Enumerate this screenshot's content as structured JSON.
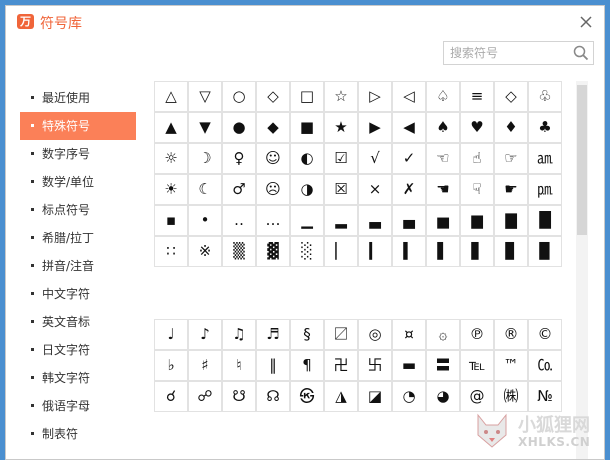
{
  "app": {
    "title": "符号库",
    "logo_glyph": "万"
  },
  "search": {
    "placeholder": "搜索符号",
    "value": ""
  },
  "sidebar": {
    "active_index": 1,
    "items": [
      {
        "label": "最近使用"
      },
      {
        "label": "特殊符号"
      },
      {
        "label": "数字序号"
      },
      {
        "label": "数学/单位"
      },
      {
        "label": "标点符号"
      },
      {
        "label": "希腊/拉丁"
      },
      {
        "label": "拼音/注音"
      },
      {
        "label": "中文字符"
      },
      {
        "label": "英文音标"
      },
      {
        "label": "日文字符"
      },
      {
        "label": "韩文字符"
      },
      {
        "label": "俄语字母"
      },
      {
        "label": "制表符"
      }
    ]
  },
  "grid1": {
    "rows": [
      [
        "△",
        "▽",
        "○",
        "◇",
        "□",
        "☆",
        "▷",
        "◁",
        "♤",
        "≡",
        "◇",
        "♧"
      ],
      [
        "▲",
        "▼",
        "●",
        "◆",
        "■",
        "★",
        "▶",
        "◀",
        "♠",
        "♥",
        "♦",
        "♣"
      ],
      [
        "☼",
        "☽",
        "♀",
        "☺",
        "◐",
        "☑",
        "√",
        "✓",
        "☜",
        "☝",
        "☞",
        "㏂"
      ],
      [
        "☀",
        "☾",
        "♂",
        "☹",
        "◑",
        "☒",
        "×",
        "✗",
        "☚",
        "☟",
        "☛",
        "㏘"
      ],
      [
        "▪",
        "•",
        "‥",
        "…",
        "▁",
        "▂",
        "▃",
        "▄",
        "▅",
        "▆",
        "▇",
        "█"
      ],
      [
        "∷",
        "※",
        "▒",
        "▓",
        "░",
        "▏",
        "▎",
        "▍",
        "▌",
        "▋",
        "▊",
        "▉"
      ]
    ]
  },
  "grid2": {
    "rows": [
      [
        "♩",
        "♪",
        "♫",
        "♬",
        "§",
        "〼",
        "◎",
        "¤",
        "۞",
        "℗",
        "®",
        "©"
      ],
      [
        "♭",
        "♯",
        "♮",
        "‖",
        "¶",
        "卍",
        "卐",
        "▬",
        "〓",
        "℡",
        "™",
        "㏇"
      ],
      [
        "☌",
        "☍",
        "☋",
        "☊",
        "㉿",
        "◮",
        "◪",
        "◔",
        "◕",
        "@",
        "㈱",
        "№"
      ]
    ]
  },
  "watermark": {
    "cn": "小狐狸网",
    "en": "XHLKS.CN"
  },
  "colors": {
    "accent": "#fb8058",
    "title": "#f0653a",
    "desktop": "#4a8fd0"
  }
}
